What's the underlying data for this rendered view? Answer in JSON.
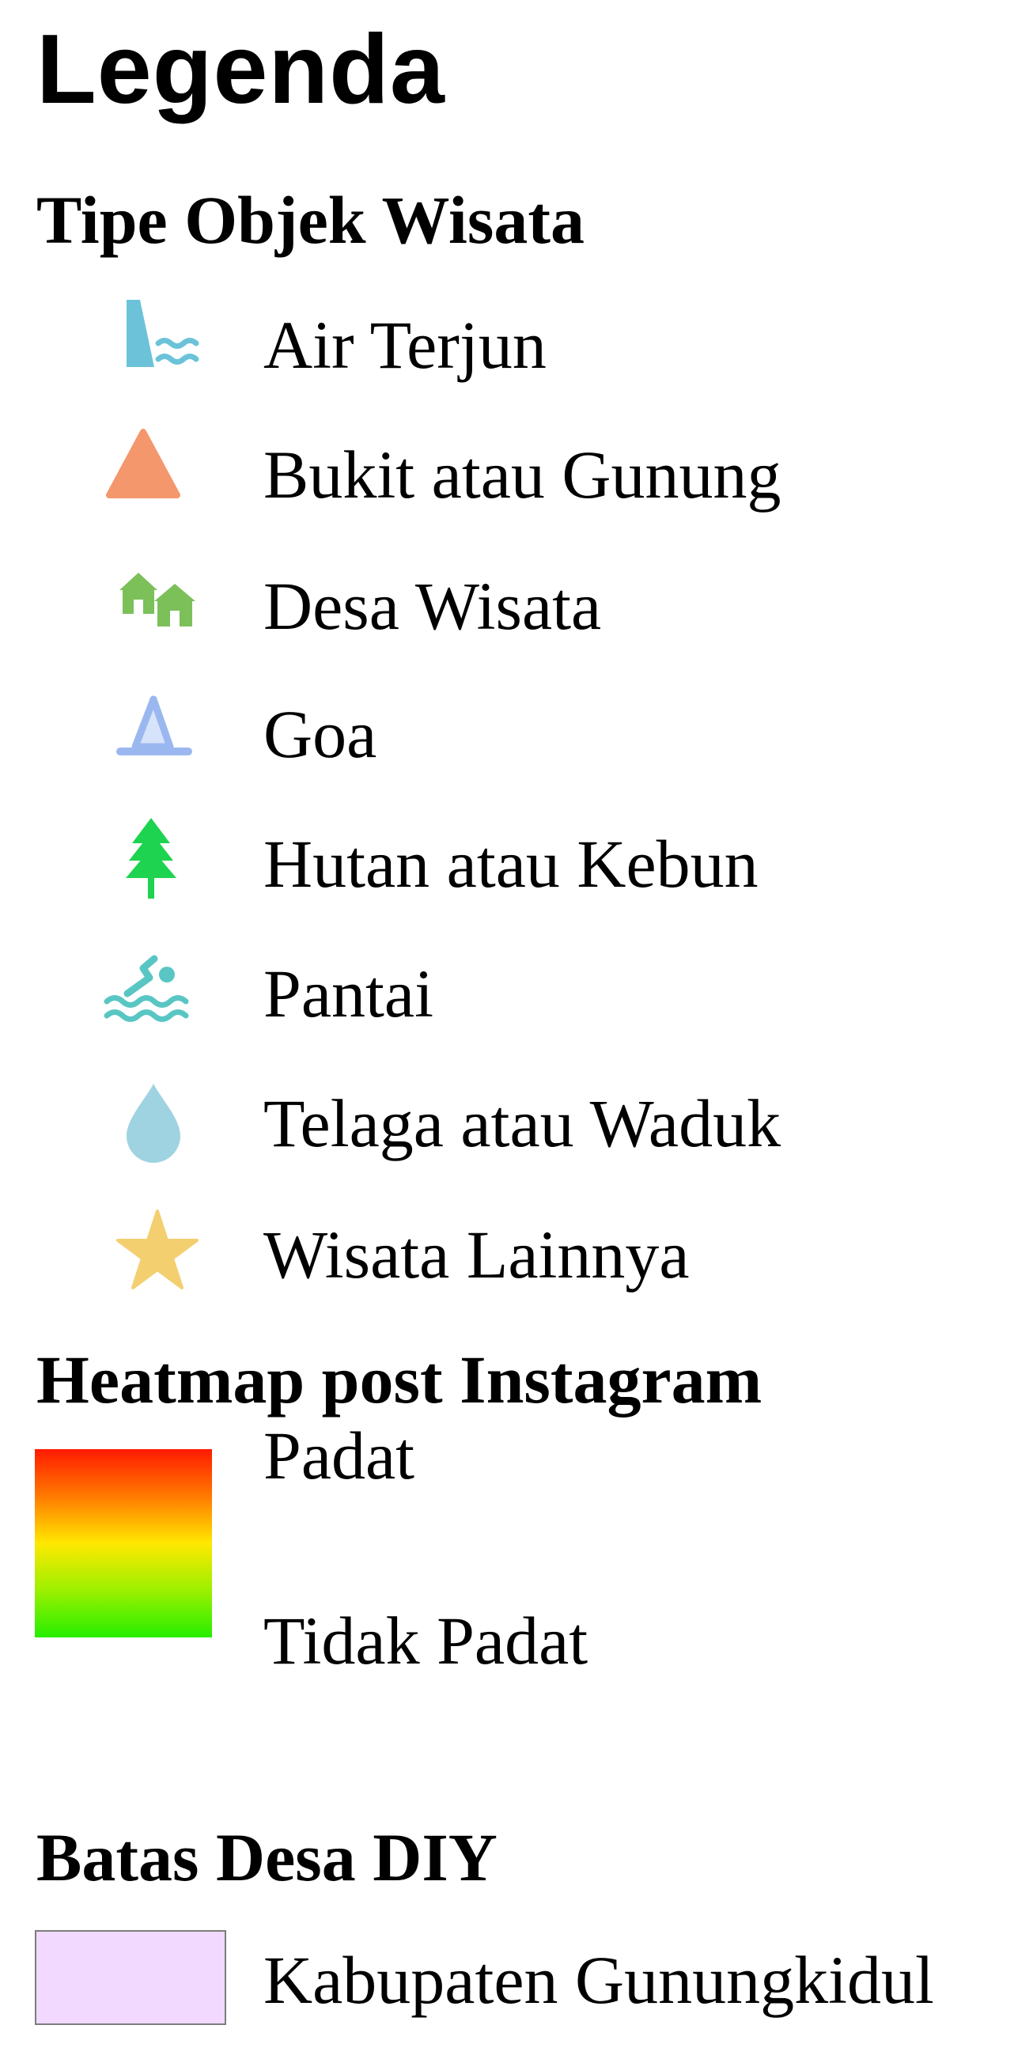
{
  "legend": {
    "title": "Legenda",
    "tourism_types": {
      "title": "Tipe Objek Wisata",
      "items": [
        {
          "label": "Air Terjun",
          "icon": "waterfall-icon",
          "color": "#6cc3d9"
        },
        {
          "label": "Bukit atau Gunung",
          "icon": "mountain-icon",
          "color": "#f4976c"
        },
        {
          "label": "Desa Wisata",
          "icon": "village-icon",
          "color": "#7cc05a"
        },
        {
          "label": "Goa",
          "icon": "cave-icon",
          "color": "#9ab8ef"
        },
        {
          "label": "Hutan atau Kebun",
          "icon": "tree-icon",
          "color": "#1ed34f"
        },
        {
          "label": "Pantai",
          "icon": "swimmer-icon",
          "color": "#59c6c4"
        },
        {
          "label": "Telaga atau Waduk",
          "icon": "water-drop-icon",
          "color": "#9fd3e1"
        },
        {
          "label": "Wisata Lainnya",
          "icon": "star-icon",
          "color": "#f3cf70"
        }
      ]
    },
    "heatmap": {
      "title": "Heatmap post Instagram",
      "high_label": "Padat",
      "low_label": "Tidak Padat",
      "gradient": [
        "#ff1a00",
        "#ff7a00",
        "#ffe800",
        "#9cf000",
        "#26ee00"
      ]
    },
    "boundary": {
      "title": "Batas Desa DIY",
      "label": "Kabupaten Gunungkidul",
      "fill_color": "#f1d9ff",
      "border_color": "#7d7d7d"
    }
  }
}
